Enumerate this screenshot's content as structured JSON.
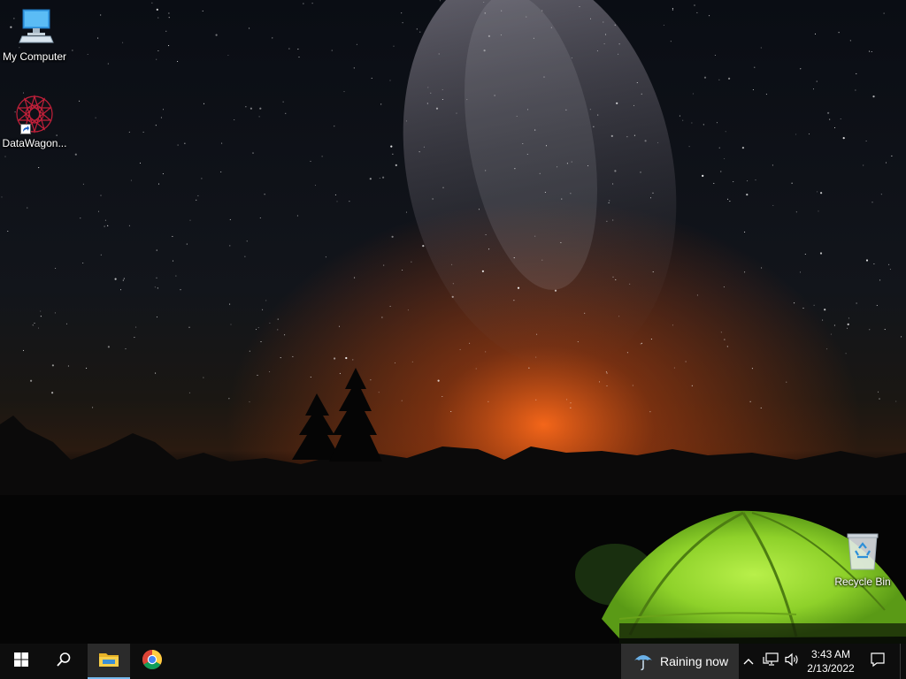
{
  "desktop": {
    "icons": [
      {
        "label": "My Computer",
        "icon": "computer-icon"
      },
      {
        "label": "DataWagon...",
        "icon": "datawagon-app-icon"
      },
      {
        "label": "Recycle Bin",
        "icon": "recycle-bin-icon"
      }
    ]
  },
  "taskbar": {
    "start": {
      "icon": "windows-logo-icon"
    },
    "search": {
      "icon": "search-icon"
    },
    "pinned": [
      {
        "icon": "file-explorer-icon",
        "active": true
      },
      {
        "icon": "chrome-icon",
        "active": false
      }
    ],
    "weather": {
      "icon": "umbrella-icon",
      "text": "Raining now"
    },
    "tray": {
      "icons": [
        "chevron-up-icon",
        "network-icon",
        "volume-icon"
      ],
      "time": "3:43 AM",
      "date": "2/13/2022",
      "notification_icon": "action-center-icon"
    }
  },
  "colors": {
    "taskbar_bg": "#0d0d0d",
    "weather_bg": "#2e2e2e",
    "active_indicator": "#76b9ed",
    "sky_top": "#0a0d14",
    "horizon_glow": "#ff6a1a",
    "tent_green": "#8ed12a"
  }
}
